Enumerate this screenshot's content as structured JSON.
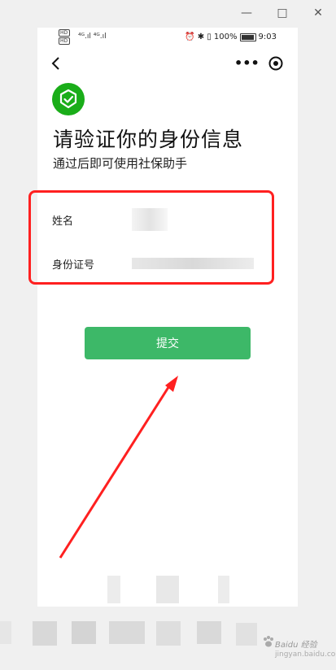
{
  "window": {
    "minimize_label": "—",
    "maximize_label": "□",
    "close_label": "✕"
  },
  "status_bar": {
    "network_left": "HD",
    "signal_text": "⁴ᴳ.ıl ⁴ᴳ.ıl ",
    "icons": "⏰ ✱ ▯ 100%",
    "time": "9:03"
  },
  "nav": {
    "back_icon": "‹",
    "more_icon": "•••",
    "close_icon": "target-icon"
  },
  "header": {
    "title": "请验证你的身份信息",
    "subtitle": "通过后即可使用社保助手"
  },
  "form": {
    "fields": [
      {
        "label": "姓名",
        "value": ""
      },
      {
        "label": "身份证号",
        "value": ""
      }
    ]
  },
  "actions": {
    "submit_label": "提交"
  },
  "colors": {
    "brand_green": "#1aad19",
    "button_green": "#3db868",
    "annotation_red": "#ff2020"
  },
  "watermark": {
    "text": "Baidu 经验",
    "url": "jingyan.baidu.com"
  }
}
